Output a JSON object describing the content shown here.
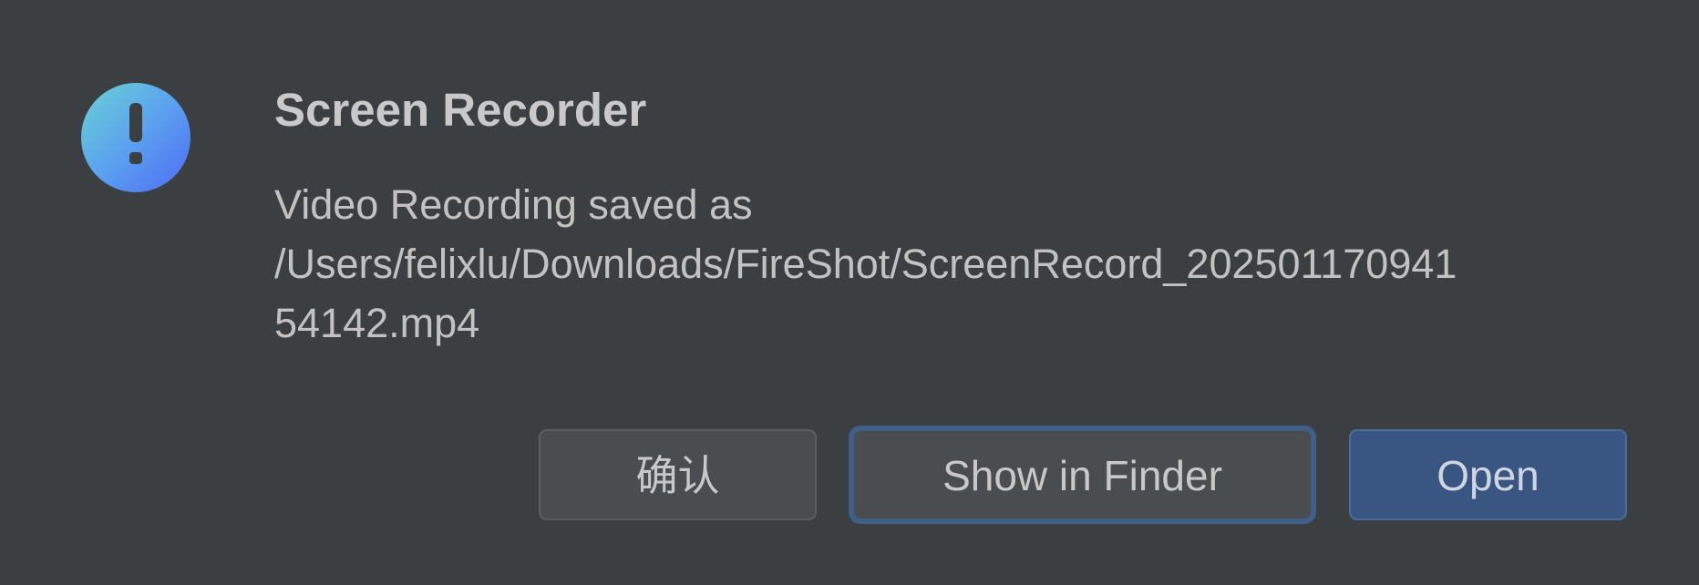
{
  "dialog": {
    "title": "Screen Recorder",
    "message_lines": [
      "Video Recording saved as",
      "/Users/felixlu/Downloads/FireShot/ScreenRecord_202501170941",
      "54142.mp4"
    ],
    "icon": "exclamation-circle-icon"
  },
  "buttons": {
    "confirm_label": "确认",
    "finder_label": "Show in Finder",
    "open_label": "Open"
  },
  "colors": {
    "background": "#3c3f41",
    "primary_button": "#395581",
    "focus_ring": "#3f5f87",
    "icon_gradient_start": "#69d3d6",
    "icon_gradient_end": "#4f6cf3"
  }
}
